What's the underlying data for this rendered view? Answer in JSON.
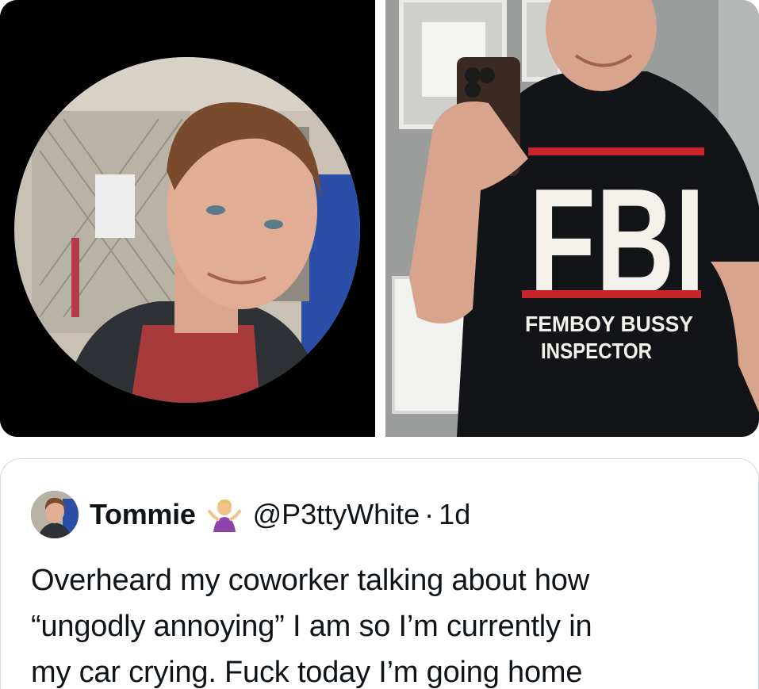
{
  "media": {
    "left_image": {
      "alt": ""
    },
    "right_image": {
      "alt": "",
      "shirt_logo": "FBI",
      "shirt_line1": "FEMBOY BUSSY",
      "shirt_line2": "INSPECTOR"
    }
  },
  "tweet": {
    "display_name": "Tommie",
    "emoji_icon": "person-shrugging-emoji",
    "handle": "@P3ttyWhite",
    "separator": "·",
    "timestamp": "1d",
    "text_lines": [
      "Overheard my coworker talking about how",
      "“ungodly annoying” I am so I’m currently in",
      "my car crying. Fuck today I’m going home"
    ]
  },
  "colors": {
    "text": "#0f1419",
    "border": "#cfd9de",
    "shirt_red": "#c8242b",
    "shirt_dark": "#111418"
  }
}
